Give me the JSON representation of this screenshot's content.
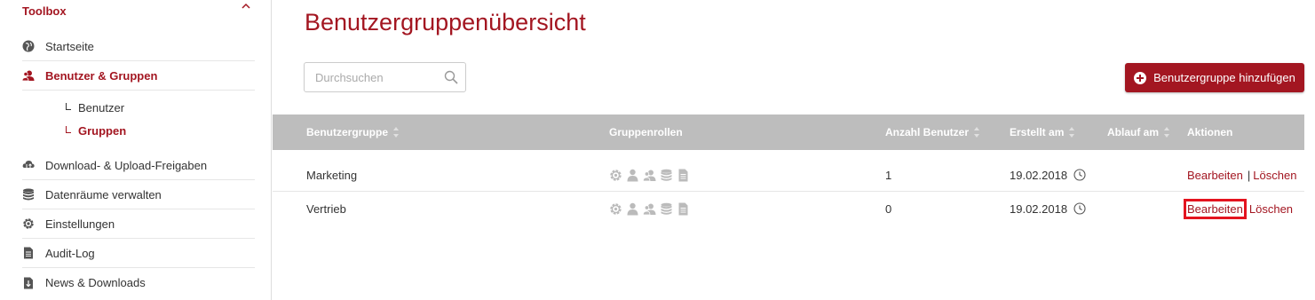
{
  "sidebar": {
    "heading": "Toolbox",
    "items": [
      {
        "label": "Startseite"
      },
      {
        "label": "Benutzer & Gruppen"
      },
      {
        "label": "Download- & Upload-Freigaben"
      },
      {
        "label": "Datenräume verwalten"
      },
      {
        "label": "Einstellungen"
      },
      {
        "label": "Audit-Log"
      },
      {
        "label": "News & Downloads"
      }
    ],
    "subitems": [
      {
        "label": "Benutzer"
      },
      {
        "label": "Gruppen"
      }
    ]
  },
  "main": {
    "title": "Benutzergruppenübersicht",
    "search": {
      "placeholder": "Durchsuchen",
      "value": ""
    },
    "add_button": "Benutzergruppe hinzufügen"
  },
  "table": {
    "headers": [
      "Benutzergruppe",
      "Gruppenrollen",
      "Anzahl Benutzer",
      "Erstellt am",
      "Ablauf am",
      "Aktionen"
    ],
    "rows": [
      {
        "name": "Marketing",
        "count": "1",
        "created": "19.02.2018",
        "expires": ""
      },
      {
        "name": "Vertrieb",
        "count": "0",
        "created": "19.02.2018",
        "expires": ""
      }
    ],
    "action_edit": "Bearbeiten",
    "action_separator": "|",
    "action_delete": "Löschen",
    "role_icons": [
      "gear-icon",
      "user-icon",
      "users-icon",
      "database-icon",
      "document-icon"
    ]
  },
  "colors": {
    "accent": "#a31621",
    "header_bg": "#bdbdbd",
    "highlight": "#e4131f"
  }
}
